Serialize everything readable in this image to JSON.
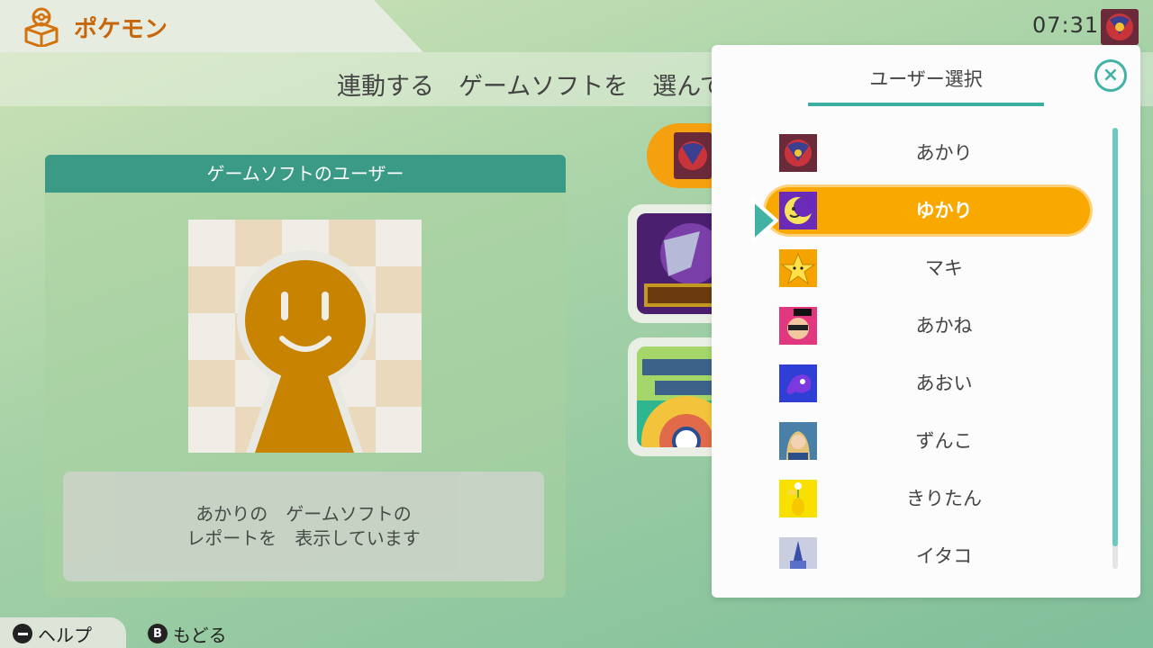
{
  "header": {
    "app_title": "ポケモン",
    "clock": "07:31",
    "instruction": "連動する　ゲームソフトを　選んで"
  },
  "left_panel": {
    "header": "ゲームソフトのユーザー",
    "message_line1": "あかりの　ゲームソフトの",
    "message_line2": "レポートを　表示しています"
  },
  "user_select": {
    "title": "ユーザー選択",
    "close_icon": "×",
    "users": [
      {
        "name": "あかり",
        "icon": "koraidon-avatar-icon"
      },
      {
        "name": "ゆかり",
        "icon": "moon-face-avatar-icon",
        "selected": true
      },
      {
        "name": "マキ",
        "icon": "super-star-avatar-icon"
      },
      {
        "name": "あかね",
        "icon": "inkling-pink-avatar-icon"
      },
      {
        "name": "あおい",
        "icon": "octoling-blue-avatar-icon"
      },
      {
        "name": "ずんこ",
        "icon": "zelda-avatar-icon"
      },
      {
        "name": "きりたん",
        "icon": "pikmin-yellow-avatar-icon"
      },
      {
        "name": "イタコ",
        "icon": "castle-avatar-icon"
      }
    ]
  },
  "bottom_bar": {
    "help_label": "ヘルプ",
    "back_button_glyph": "B",
    "back_label": "もどる"
  },
  "colors": {
    "accent_teal": "#3aaea0",
    "selected_orange": "#f9a800",
    "app_title_orange": "#c7660a"
  }
}
